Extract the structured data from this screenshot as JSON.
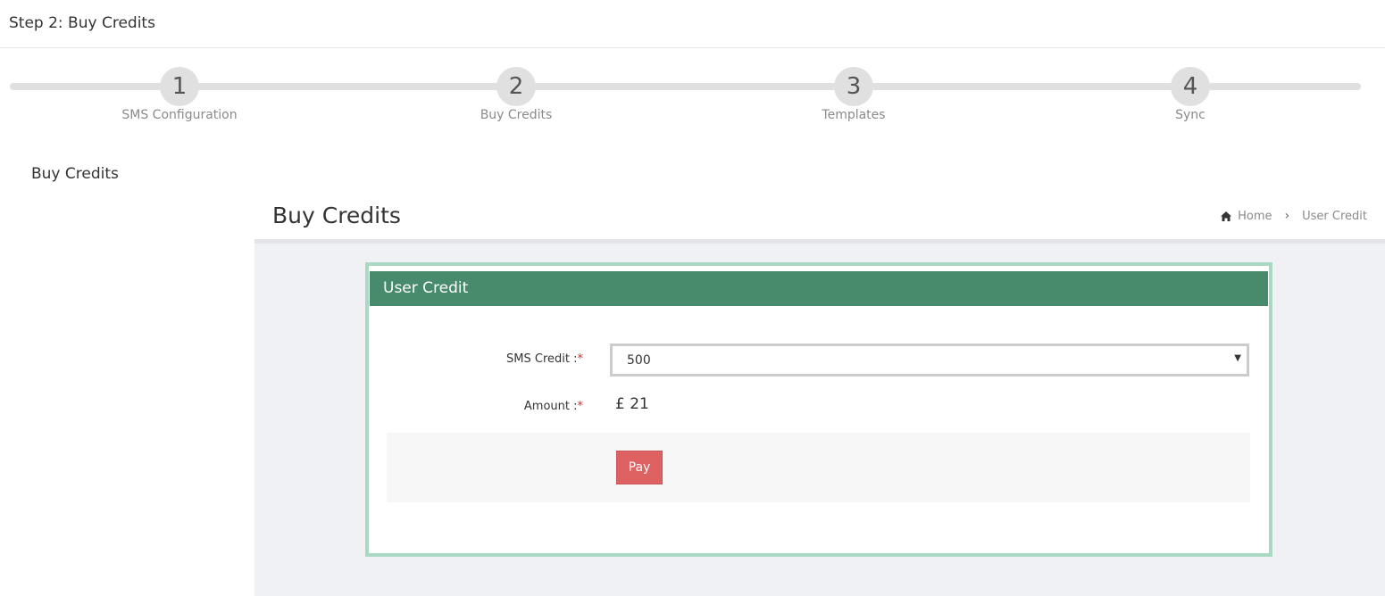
{
  "header": {
    "title": "Step 2: Buy Credits"
  },
  "wizard": {
    "steps": [
      {
        "number": "1",
        "label": "SMS Configuration"
      },
      {
        "number": "2",
        "label": "Buy Credits"
      },
      {
        "number": "3",
        "label": "Templates"
      },
      {
        "number": "4",
        "label": "Sync"
      }
    ]
  },
  "section": {
    "title": "Buy Credits"
  },
  "page": {
    "title": "Buy Credits",
    "breadcrumb": {
      "home": "Home",
      "separator": "›",
      "current": "User Credit"
    }
  },
  "panel": {
    "title": "User Credit",
    "sms_credit_label": "SMS Credit :",
    "sms_credit_value": "500",
    "amount_label": "Amount :",
    "amount_value": "£ 21",
    "required_mark": "*",
    "pay_label": "Pay"
  },
  "colors": {
    "panel_header": "#488b6c",
    "panel_border": "#a9d9c2",
    "pay_button": "#df6263"
  }
}
